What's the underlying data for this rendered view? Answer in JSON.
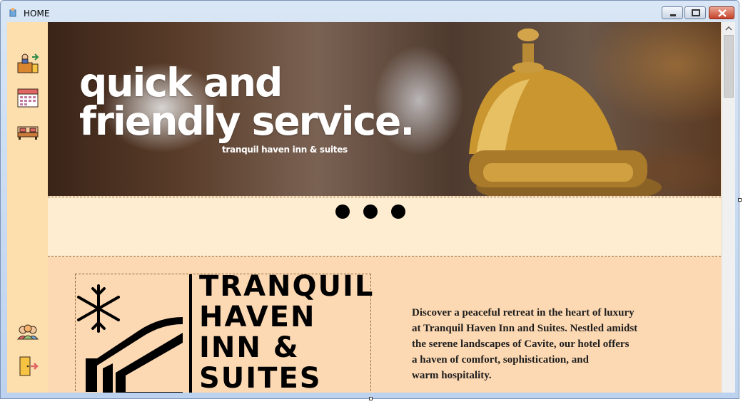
{
  "window": {
    "title": "HOME"
  },
  "sidebar": {
    "items": [
      {
        "name": "reception",
        "icon": "receptionist-icon"
      },
      {
        "name": "reservations",
        "icon": "calendar-icon"
      },
      {
        "name": "rooms",
        "icon": "bed-icon"
      },
      {
        "name": "guests",
        "icon": "users-icon"
      },
      {
        "name": "logout",
        "icon": "exit-door-icon"
      }
    ]
  },
  "hero": {
    "title": "quick and\nfriendly service.",
    "subtitle": "tranquil haven inn & suites"
  },
  "carousel": {
    "dot_count": 3
  },
  "about": {
    "logo_lines": [
      "TRANQUIL",
      "HAVEN",
      "INN &",
      "SUITES"
    ],
    "text": "Discover a peaceful retreat in the heart of luxury\nat Tranquil Haven Inn and Suites. Nestled amidst\nthe serene landscapes of Cavite, our hotel offers\na haven of comfort, sophistication, and\nwarm hospitality."
  },
  "colors": {
    "sidebar": "#fddfae",
    "dots_panel": "#feedd0",
    "about_panel": "#fdd9b3"
  }
}
